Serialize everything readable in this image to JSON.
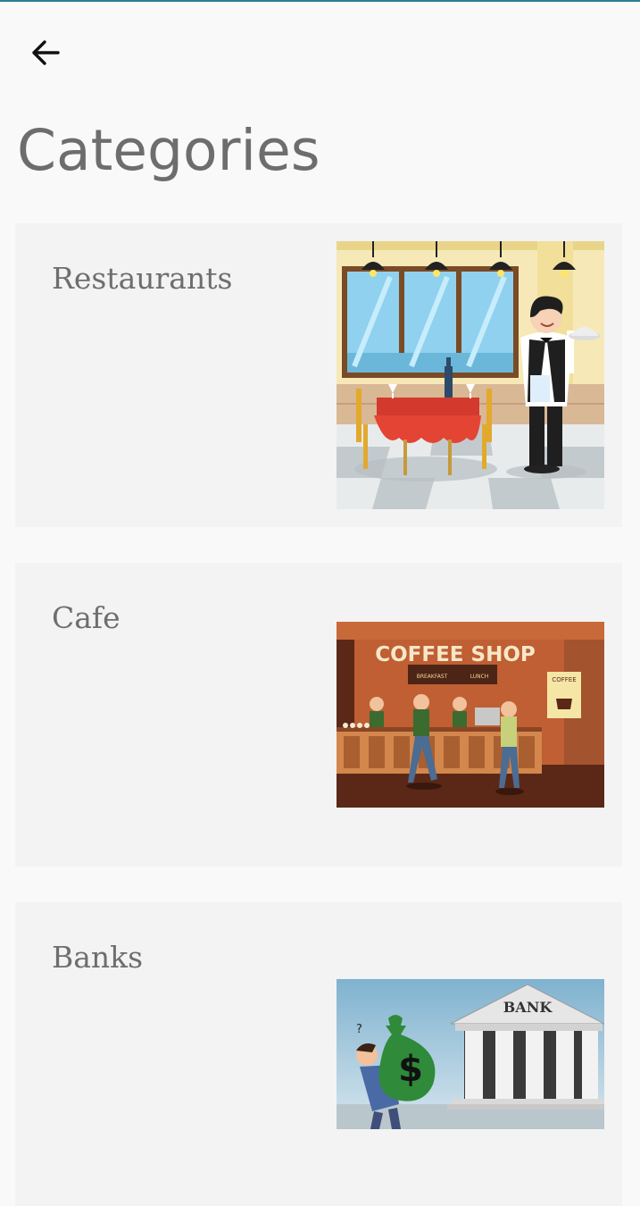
{
  "header": {
    "back_icon": "arrow-left-icon",
    "title": "Categories"
  },
  "categories": [
    {
      "label": "Restaurants",
      "image": "restaurant-waiter-illustration"
    },
    {
      "label": "Cafe",
      "image": "coffee-shop-illustration",
      "sign": "COFFEE SHOP",
      "menu_left": "BREAKFAST",
      "menu_right": "LUNCH",
      "poster": "COFFEE"
    },
    {
      "label": "Banks",
      "image": "bank-illustration",
      "sign": "BANK"
    }
  ]
}
